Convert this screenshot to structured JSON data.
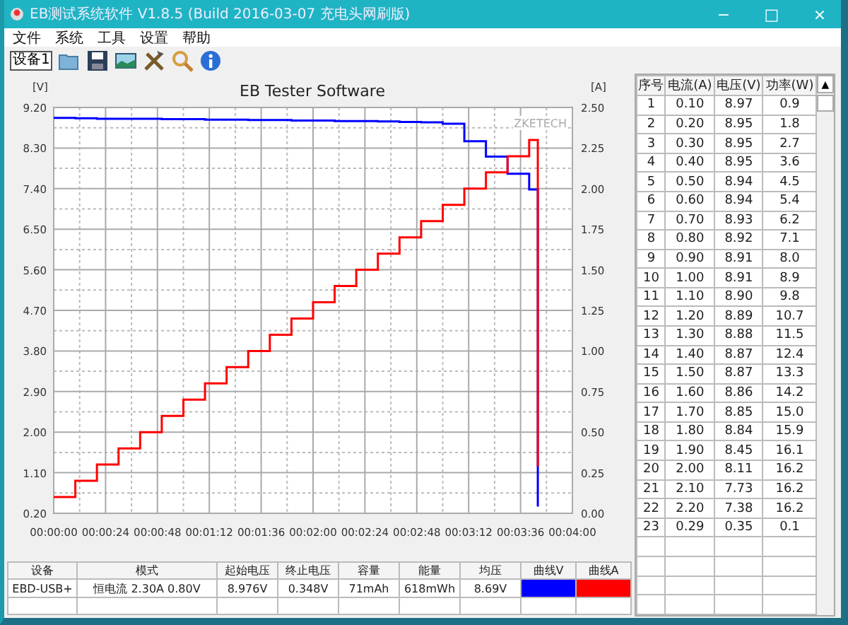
{
  "window": {
    "title": "EB测试系统软件 V1.8.5 (Build 2016-03-07 充电头网刷版)",
    "controls": [
      "−",
      "□",
      "×"
    ]
  },
  "menu": [
    "文件",
    "系统",
    "工具",
    "设置",
    "帮助"
  ],
  "toolbar": {
    "device_tab": "设备1"
  },
  "chart": {
    "brand": "ZKETECH",
    "left_unit": "[V]",
    "right_unit": "[A]",
    "chart_data": {
      "type": "line",
      "title": "EB Tester Software",
      "grid": true,
      "x": [
        0,
        10,
        10,
        20,
        20,
        30,
        30,
        40,
        40,
        50,
        50,
        60,
        60,
        70,
        70,
        80,
        80,
        90,
        90,
        100,
        100,
        110,
        110,
        120,
        120,
        130,
        130,
        140,
        140,
        150,
        150,
        160,
        160,
        170,
        170,
        180,
        180,
        190,
        190,
        200,
        200,
        210,
        210,
        220,
        220,
        224,
        224
      ],
      "xlim": [
        0,
        240
      ],
      "xticks": [
        {
          "value": 0,
          "label": "00:00:00"
        },
        {
          "value": 24,
          "label": "00:00:24"
        },
        {
          "value": 48,
          "label": "00:00:48"
        },
        {
          "value": 72,
          "label": "00:01:12"
        },
        {
          "value": 96,
          "label": "00:01:36"
        },
        {
          "value": 120,
          "label": "00:02:00"
        },
        {
          "value": 144,
          "label": "00:02:24"
        },
        {
          "value": 168,
          "label": "00:02:48"
        },
        {
          "value": 192,
          "label": "00:03:12"
        },
        {
          "value": 216,
          "label": "00:03:36"
        },
        {
          "value": 240,
          "label": "00:04:00"
        }
      ],
      "ylim": [
        0.2,
        9.2
      ],
      "yticks": [
        {
          "value": 0.2,
          "label": "0.20"
        },
        {
          "value": 1.1,
          "label": "1.10"
        },
        {
          "value": 2.0,
          "label": "2.00"
        },
        {
          "value": 2.9,
          "label": "2.90"
        },
        {
          "value": 3.8,
          "label": "3.80"
        },
        {
          "value": 4.7,
          "label": "4.70"
        },
        {
          "value": 5.6,
          "label": "5.60"
        },
        {
          "value": 6.5,
          "label": "6.50"
        },
        {
          "value": 7.4,
          "label": "7.40"
        },
        {
          "value": 8.3,
          "label": "8.30"
        },
        {
          "value": 9.2,
          "label": "9.20"
        }
      ],
      "y2lim": [
        0,
        2.5
      ],
      "y2ticks": [
        {
          "value": 0,
          "label": "0.00"
        },
        {
          "value": 0.25,
          "label": "0.25"
        },
        {
          "value": 0.5,
          "label": "0.50"
        },
        {
          "value": 0.75,
          "label": "0.75"
        },
        {
          "value": 1.0,
          "label": "1.00"
        },
        {
          "value": 1.25,
          "label": "1.25"
        },
        {
          "value": 1.5,
          "label": "1.50"
        },
        {
          "value": 1.75,
          "label": "1.75"
        },
        {
          "value": 2.0,
          "label": "2.00"
        },
        {
          "value": 2.25,
          "label": "2.25"
        },
        {
          "value": 2.5,
          "label": "2.50"
        }
      ],
      "series": [
        {
          "name": "曲线V",
          "color": "#0000ff",
          "values": [
            8.97,
            8.97,
            8.96,
            8.96,
            8.95,
            8.95,
            8.95,
            8.95,
            8.95,
            8.95,
            8.94,
            8.94,
            8.94,
            8.94,
            8.93,
            8.93,
            8.93,
            8.93,
            8.92,
            8.92,
            8.92,
            8.92,
            8.91,
            8.91,
            8.91,
            8.91,
            8.9,
            8.9,
            8.9,
            8.9,
            8.89,
            8.89,
            8.88,
            8.88,
            8.87,
            8.87,
            8.84,
            8.84,
            8.45,
            8.45,
            8.11,
            8.11,
            7.73,
            7.73,
            7.38,
            7.38,
            0.35
          ]
        },
        {
          "name": "曲线A",
          "color": "#ff0000",
          "axis": "y2",
          "values": [
            0.1,
            0.1,
            0.2,
            0.2,
            0.3,
            0.3,
            0.4,
            0.4,
            0.5,
            0.5,
            0.6,
            0.6,
            0.7,
            0.7,
            0.8,
            0.8,
            0.9,
            0.9,
            1.0,
            1.0,
            1.1,
            1.1,
            1.2,
            1.2,
            1.3,
            1.3,
            1.4,
            1.4,
            1.5,
            1.5,
            1.6,
            1.6,
            1.7,
            1.7,
            1.8,
            1.8,
            1.9,
            1.9,
            2.0,
            2.0,
            2.1,
            2.1,
            2.2,
            2.2,
            2.3,
            2.3,
            0.29
          ]
        }
      ]
    }
  },
  "summary": {
    "columns": [
      "设备",
      "模式",
      "起始电压",
      "终止电压",
      "容量",
      "能量",
      "均压"
    ],
    "rows": [
      {
        "cells": [
          "EBD-USB+",
          "恒电流 2.30A 0.80V",
          "8.976V",
          "0.348V",
          "71mAh",
          "618mWh",
          "8.69V"
        ]
      }
    ]
  },
  "readings": {
    "columns": [
      "序号",
      "电流(A)",
      "电压(V)",
      "功率(W)"
    ],
    "rows": [
      [
        "1",
        "0.10",
        "8.97",
        "0.9"
      ],
      [
        "2",
        "0.20",
        "8.95",
        "1.8"
      ],
      [
        "3",
        "0.30",
        "8.95",
        "2.7"
      ],
      [
        "4",
        "0.40",
        "8.95",
        "3.6"
      ],
      [
        "5",
        "0.50",
        "8.94",
        "4.5"
      ],
      [
        "6",
        "0.60",
        "8.94",
        "5.4"
      ],
      [
        "7",
        "0.70",
        "8.93",
        "6.2"
      ],
      [
        "8",
        "0.80",
        "8.92",
        "7.1"
      ],
      [
        "9",
        "0.90",
        "8.91",
        "8.0"
      ],
      [
        "10",
        "1.00",
        "8.91",
        "8.9"
      ],
      [
        "11",
        "1.10",
        "8.90",
        "9.8"
      ],
      [
        "12",
        "1.20",
        "8.89",
        "10.7"
      ],
      [
        "13",
        "1.30",
        "8.88",
        "11.5"
      ],
      [
        "14",
        "1.40",
        "8.87",
        "12.4"
      ],
      [
        "15",
        "1.50",
        "8.87",
        "13.3"
      ],
      [
        "16",
        "1.60",
        "8.86",
        "14.2"
      ],
      [
        "17",
        "1.70",
        "8.85",
        "15.0"
      ],
      [
        "18",
        "1.80",
        "8.84",
        "15.9"
      ],
      [
        "19",
        "1.90",
        "8.45",
        "16.1"
      ],
      [
        "20",
        "2.00",
        "8.11",
        "16.2"
      ],
      [
        "21",
        "2.10",
        "7.73",
        "16.2"
      ],
      [
        "22",
        "2.20",
        "7.38",
        "16.2"
      ],
      [
        "23",
        "0.29",
        "0.35",
        "0.1"
      ]
    ],
    "scroll_up": "▲"
  }
}
